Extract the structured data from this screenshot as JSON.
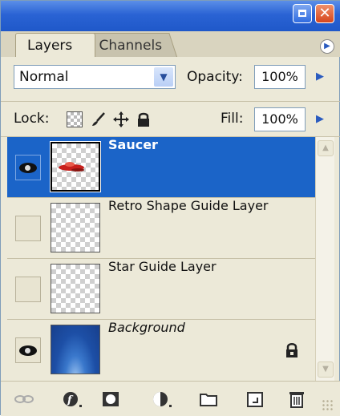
{
  "tabs": {
    "active": "Layers",
    "inactive": "Channels"
  },
  "blend": {
    "mode": "Normal",
    "opacity_label": "Opacity:",
    "opacity_value": "100%"
  },
  "lock": {
    "label": "Lock:",
    "fill_label": "Fill:",
    "fill_value": "100%"
  },
  "layers": [
    {
      "name": "Saucer",
      "visible": true,
      "selected": true
    },
    {
      "name": "Retro Shape Guide Layer",
      "visible": false,
      "selected": false
    },
    {
      "name": "Star Guide Layer",
      "visible": false,
      "selected": false
    },
    {
      "name": "Background",
      "visible": true,
      "selected": false,
      "locked": true
    }
  ],
  "icons": {
    "lock_transparent": "checkerboard-icon",
    "lock_image": "brush-icon",
    "lock_position": "move-icon",
    "lock_all": "padlock-icon",
    "bottom": [
      "link-icon",
      "layer-style-icon",
      "layer-mask-icon",
      "adjustment-layer-icon",
      "folder-icon",
      "new-layer-icon",
      "trash-icon"
    ]
  },
  "colors": {
    "selection": "#1B64C8",
    "panel": "#ECE9D8",
    "titlebar": "#2A63D4",
    "close": "#D6451C"
  }
}
